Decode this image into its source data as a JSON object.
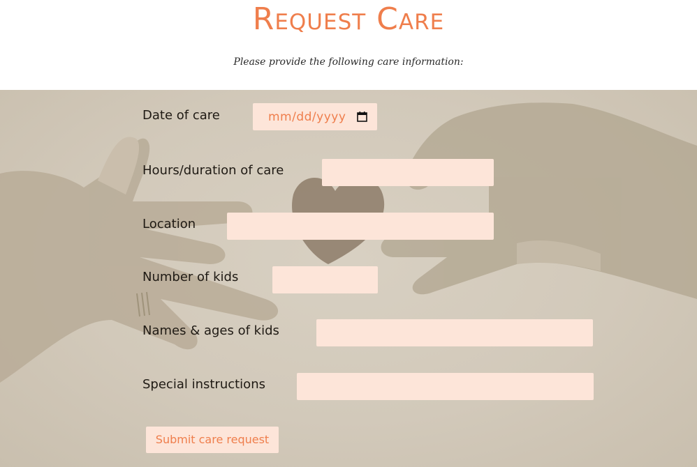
{
  "header": {
    "title": "Request Care",
    "subtitle": "Please provide the following care information:"
  },
  "form": {
    "fields": [
      {
        "label": "Date of care",
        "placeholder": "mm/dd/yyyy",
        "type": "date"
      },
      {
        "label": "Hours/duration of care",
        "placeholder": "",
        "type": "text"
      },
      {
        "label": "Location",
        "placeholder": "",
        "type": "text"
      },
      {
        "label": "Number of kids",
        "placeholder": "",
        "type": "text"
      },
      {
        "label": "Names & ages of kids",
        "placeholder": "",
        "type": "text"
      },
      {
        "label": "Special instructions",
        "placeholder": "",
        "type": "text"
      }
    ],
    "submit_label": "Submit care request",
    "calendar_icon": "calendar-icon"
  },
  "colors": {
    "accent": "#ef7e4c",
    "input_bg": "#fde5d9",
    "label_text": "#1f1a14",
    "panel_bg": "#d2c9ba"
  }
}
